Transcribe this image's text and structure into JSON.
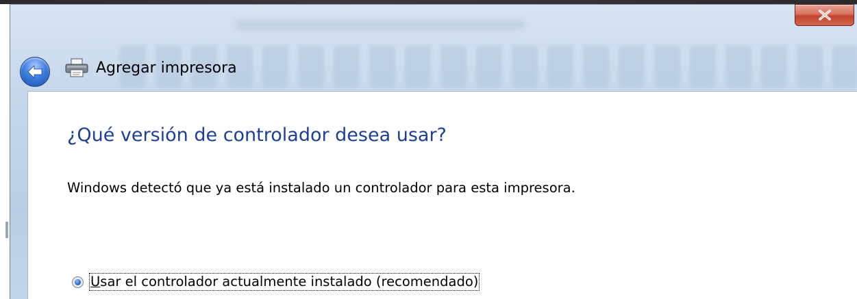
{
  "window": {
    "title": "Agregar impresora",
    "close_glyph": "x"
  },
  "icons": {
    "back": "back-arrow-icon",
    "printer": "printer-icon",
    "close": "close-icon"
  },
  "content": {
    "instruction": "¿Qué versión de controlador desea usar?",
    "description": "Windows detectó que ya está instalado un controlador para esta impresora.",
    "options": [
      {
        "access_key": "U",
        "label_rest": "sar el controlador actualmente instalado (recomendado)",
        "selected": true
      }
    ]
  },
  "colors": {
    "instruction": "#1e3f96",
    "close_button": "#c4422a",
    "back_button": "#3f7ee0"
  }
}
